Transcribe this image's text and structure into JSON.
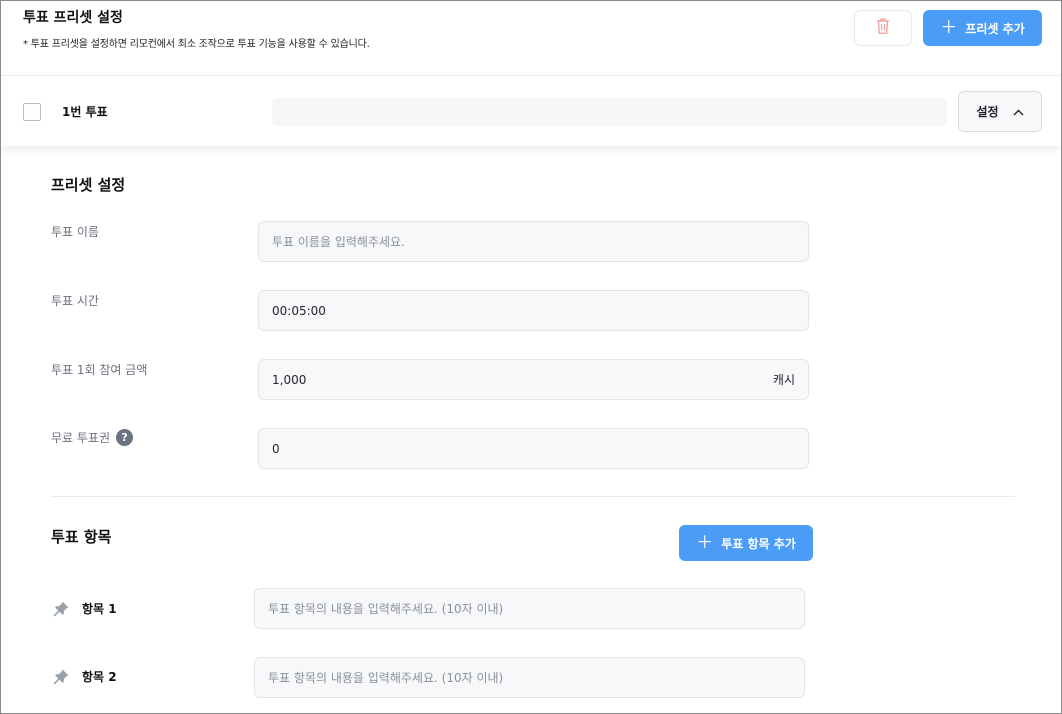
{
  "header": {
    "title": "투표 프리셋 설정",
    "description": "* 투표 프리셋을 설정하면 리모컨에서 최소 조작으로 투표 기능을 사용할 수 있습니다.",
    "add_preset_label": "프리셋 추가"
  },
  "preset": {
    "name": "1번 투표",
    "checked": false,
    "settings_label": "설정"
  },
  "preset_settings": {
    "title": "프리셋 설정",
    "fields": [
      {
        "label": "투표 이름",
        "value": "",
        "placeholder": "투표 이름을 입력해주세요."
      },
      {
        "label": "투표 시간",
        "value": "00:05:00"
      },
      {
        "label": "투표 1회 참여 금액",
        "value": "1,000",
        "unit": "캐시"
      },
      {
        "label": "무료 투표권",
        "value": "0",
        "help": "?"
      }
    ]
  },
  "vote_items": {
    "title": "투표 항목",
    "add_label": "투표 항목 추가",
    "items": [
      {
        "label": "항목 1",
        "placeholder": "투표 항목의 내용을 입력해주세요. (10자 이내)"
      },
      {
        "label": "항목 2",
        "placeholder": "투표 항목의 내용을 입력해주세요. (10자 이내)"
      }
    ]
  },
  "colors": {
    "accent": "#4a9cf7",
    "trash_icon": "#f5a3a3",
    "input_bg": "#f7f8fa"
  },
  "icons": [
    "trash-icon",
    "plus-icon",
    "chevron-up-icon",
    "help-icon",
    "pin-icon"
  ]
}
